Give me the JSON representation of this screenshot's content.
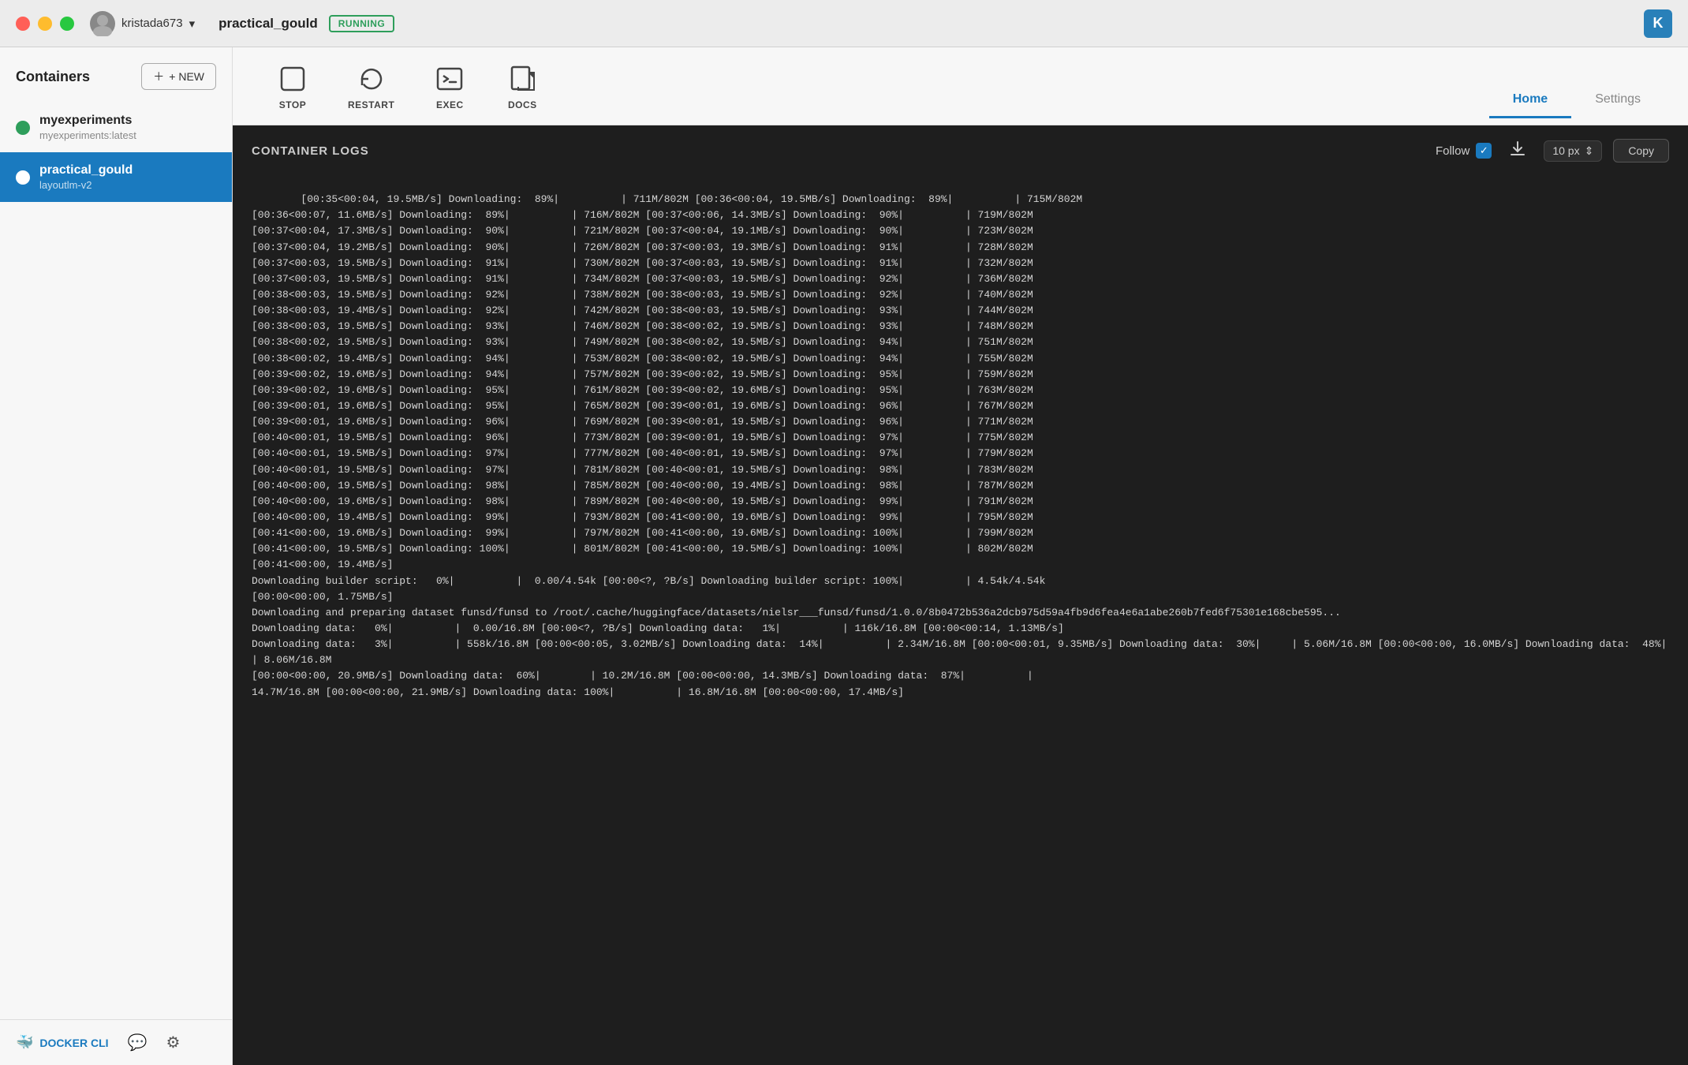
{
  "titlebar": {
    "user": "kristada673",
    "user_initials": "K",
    "container_name": "practical_gould",
    "status": "RUNNING",
    "kube_icon": "K"
  },
  "sidebar": {
    "title": "Containers",
    "new_button": "+ NEW",
    "items": [
      {
        "name": "myexperiments",
        "tag": "myexperiments:latest",
        "status": "running",
        "active": false
      },
      {
        "name": "practical_gould",
        "tag": "layoutlm-v2",
        "status": "running",
        "active": true
      }
    ],
    "docker_cli_label": "DOCKER CLI"
  },
  "toolbar": {
    "actions": [
      {
        "id": "stop",
        "label": "STOP",
        "icon": "stop"
      },
      {
        "id": "restart",
        "label": "RESTART",
        "icon": "restart"
      },
      {
        "id": "exec",
        "label": "EXEC",
        "icon": "exec"
      },
      {
        "id": "docs",
        "label": "DOCS",
        "icon": "docs"
      }
    ]
  },
  "tabs": [
    {
      "id": "home",
      "label": "Home",
      "active": true
    },
    {
      "id": "settings",
      "label": "Settings",
      "active": false
    }
  ],
  "logs": {
    "title": "CONTAINER LOGS",
    "follow_label": "Follow",
    "font_size": "10 px",
    "copy_label": "Copy",
    "content": "[00:35<00:04, 19.5MB/s] Downloading:  89%|          | 711M/802M [00:36<00:04, 19.5MB/s] Downloading:  89%|          | 715M/802M\n[00:36<00:07, 11.6MB/s] Downloading:  89%|          | 716M/802M [00:37<00:06, 14.3MB/s] Downloading:  90%|          | 719M/802M\n[00:37<00:04, 17.3MB/s] Downloading:  90%|          | 721M/802M [00:37<00:04, 19.1MB/s] Downloading:  90%|          | 723M/802M\n[00:37<00:04, 19.2MB/s] Downloading:  90%|          | 726M/802M [00:37<00:03, 19.3MB/s] Downloading:  91%|          | 728M/802M\n[00:37<00:03, 19.5MB/s] Downloading:  91%|          | 730M/802M [00:37<00:03, 19.5MB/s] Downloading:  91%|          | 732M/802M\n[00:37<00:03, 19.5MB/s] Downloading:  91%|          | 734M/802M [00:37<00:03, 19.5MB/s] Downloading:  92%|          | 736M/802M\n[00:38<00:03, 19.5MB/s] Downloading:  92%|          | 738M/802M [00:38<00:03, 19.5MB/s] Downloading:  92%|          | 740M/802M\n[00:38<00:03, 19.4MB/s] Downloading:  92%|          | 742M/802M [00:38<00:03, 19.5MB/s] Downloading:  93%|          | 744M/802M\n[00:38<00:03, 19.5MB/s] Downloading:  93%|          | 746M/802M [00:38<00:02, 19.5MB/s] Downloading:  93%|          | 748M/802M\n[00:38<00:02, 19.5MB/s] Downloading:  93%|          | 749M/802M [00:38<00:02, 19.5MB/s] Downloading:  94%|          | 751M/802M\n[00:38<00:02, 19.4MB/s] Downloading:  94%|          | 753M/802M [00:38<00:02, 19.5MB/s] Downloading:  94%|          | 755M/802M\n[00:39<00:02, 19.6MB/s] Downloading:  94%|          | 757M/802M [00:39<00:02, 19.5MB/s] Downloading:  95%|          | 759M/802M\n[00:39<00:02, 19.6MB/s] Downloading:  95%|          | 761M/802M [00:39<00:02, 19.6MB/s] Downloading:  95%|          | 763M/802M\n[00:39<00:01, 19.6MB/s] Downloading:  95%|          | 765M/802M [00:39<00:01, 19.6MB/s] Downloading:  96%|          | 767M/802M\n[00:39<00:01, 19.6MB/s] Downloading:  96%|          | 769M/802M [00:39<00:01, 19.5MB/s] Downloading:  96%|          | 771M/802M\n[00:40<00:01, 19.5MB/s] Downloading:  96%|          | 773M/802M [00:39<00:01, 19.5MB/s] Downloading:  97%|          | 775M/802M\n[00:40<00:01, 19.5MB/s] Downloading:  97%|          | 777M/802M [00:40<00:01, 19.5MB/s] Downloading:  97%|          | 779M/802M\n[00:40<00:01, 19.5MB/s] Downloading:  97%|          | 781M/802M [00:40<00:01, 19.5MB/s] Downloading:  98%|          | 783M/802M\n[00:40<00:00, 19.5MB/s] Downloading:  98%|          | 785M/802M [00:40<00:00, 19.4MB/s] Downloading:  98%|          | 787M/802M\n[00:40<00:00, 19.6MB/s] Downloading:  98%|          | 789M/802M [00:40<00:00, 19.5MB/s] Downloading:  99%|          | 791M/802M\n[00:40<00:00, 19.4MB/s] Downloading:  99%|          | 793M/802M [00:41<00:00, 19.6MB/s] Downloading:  99%|          | 795M/802M\n[00:41<00:00, 19.6MB/s] Downloading:  99%|          | 797M/802M [00:41<00:00, 19.6MB/s] Downloading: 100%|          | 799M/802M\n[00:41<00:00, 19.5MB/s] Downloading: 100%|          | 801M/802M [00:41<00:00, 19.5MB/s] Downloading: 100%|          | 802M/802M\n[00:41<00:00, 19.4MB/s]\nDownloading builder script:   0%|          |  0.00/4.54k [00:00<?, ?B/s] Downloading builder script: 100%|          | 4.54k/4.54k\n[00:00<00:00, 1.75MB/s]\nDownloading and preparing dataset funsd/funsd to /root/.cache/huggingface/datasets/nielsr___funsd/funsd/1.0.0/8b0472b536a2dcb975d59a4fb9d6fea4e6a1abe260b7fed6f75301e168cbe595...\nDownloading data:   0%|          |  0.00/16.8M [00:00<?, ?B/s] Downloading data:   1%|          | 116k/16.8M [00:00<00:14, 1.13MB/s]\nDownloading data:   3%|          | 558k/16.8M [00:00<00:05, 3.02MB/s] Downloading data:  14%|          | 2.34M/16.8M [00:00<00:01, 9.35MB/s] Downloading data:  30%|     | 5.06M/16.8M [00:00<00:00, 16.0MB/s] Downloading data:  48%|       | 8.06M/16.8M\n[00:00<00:00, 20.9MB/s] Downloading data:  60%|        | 10.2M/16.8M [00:00<00:00, 14.3MB/s] Downloading data:  87%|          |\n14.7M/16.8M [00:00<00:00, 21.9MB/s] Downloading data: 100%|          | 16.8M/16.8M [00:00<00:00, 17.4MB/s]"
  }
}
